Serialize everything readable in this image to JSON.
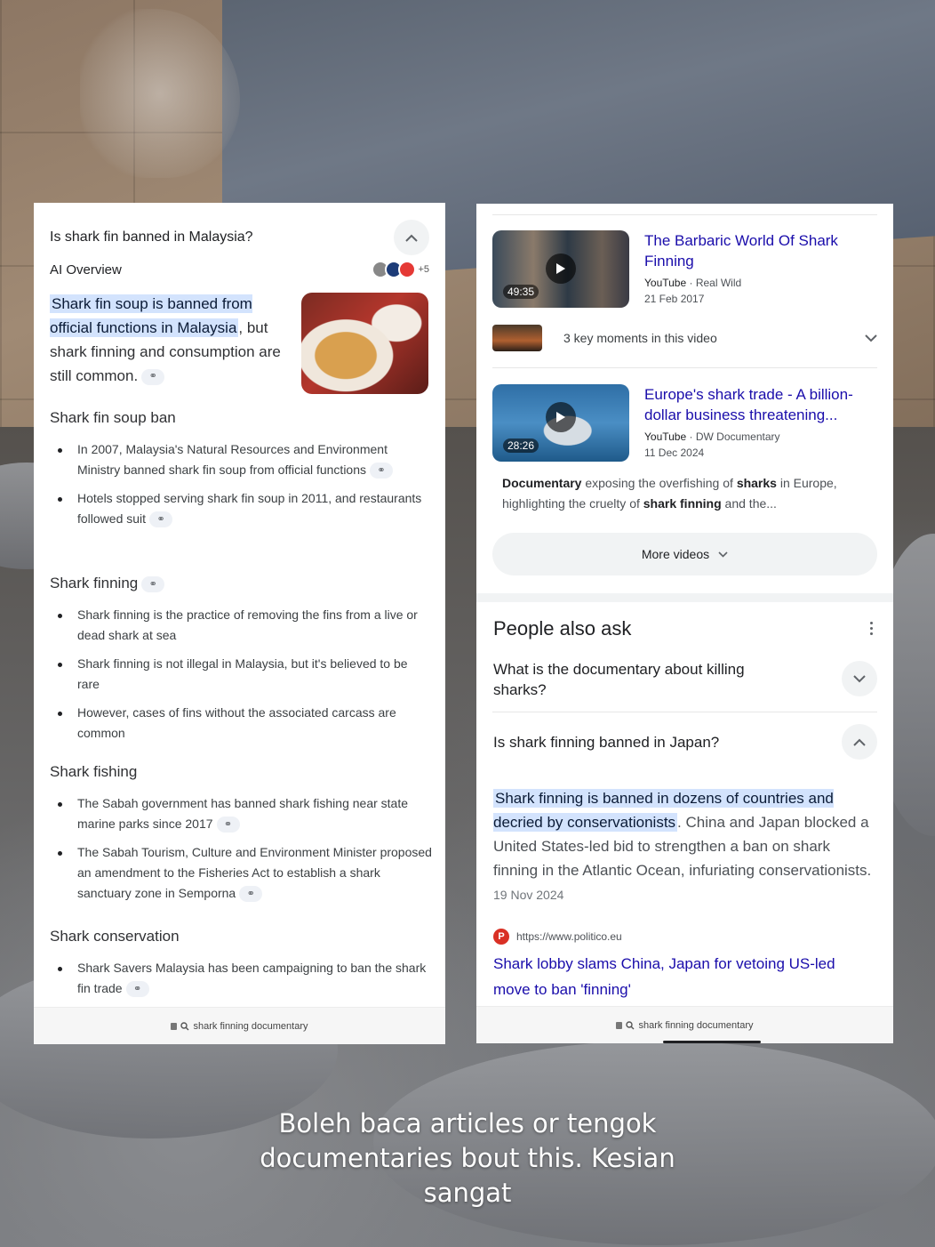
{
  "caption": "Boleh baca articles or tengok documentaries bout this. Kesian sangat",
  "left": {
    "question": "Is shark fin banned in Malaysia?",
    "ai_overview_label": "AI Overview",
    "sources_more": "+5",
    "lead_highlight": "Shark fin soup is banned from official functions in Malaysia",
    "lead_rest": ", but shark finning and consumption are still common.",
    "sections": [
      {
        "heading": "Shark fin soup ban",
        "items": [
          "In 2007, Malaysia's Natural Resources and Environment Ministry banned shark fin soup from official functions",
          "Hotels stopped serving shark fin soup in 2011, and restaurants followed suit"
        ]
      },
      {
        "heading": "Shark finning",
        "items": [
          "Shark finning is the practice of removing the fins from a live or dead shark at sea",
          "Shark finning is not illegal in Malaysia, but it's believed to be rare",
          "However, cases of fins without the associated carcass are common"
        ]
      },
      {
        "heading": "Shark fishing",
        "items": [
          "The Sabah government has banned shark fishing near state marine parks since 2017",
          "The Sabah Tourism, Culture and Environment Minister proposed an amendment to the Fisheries Act to establish a shark sanctuary zone in Semporna"
        ]
      },
      {
        "heading": "Shark conservation",
        "items": [
          "Shark Savers Malaysia has been campaigning to ban the shark fin trade"
        ]
      }
    ],
    "url_bar": "shark finning documentary"
  },
  "right": {
    "videos": [
      {
        "title": "The Barbaric World Of Shark Finning",
        "source": "YouTube",
        "channel": "Real Wild",
        "date": "21 Feb 2017",
        "duration": "49:35"
      },
      {
        "title": "Europe's shark trade - A billion-dollar business threatening...",
        "source": "YouTube",
        "channel": "DW Documentary",
        "date": "11 Dec 2024",
        "duration": "28:26"
      }
    ],
    "key_moments": "3 key moments in this video",
    "description_parts": [
      "Documentary",
      " exposing the overfishing of ",
      "sharks",
      " in Europe, highlighting the cruelty of ",
      "shark finning",
      " and the..."
    ],
    "more_videos": "More videos",
    "paa_title": "People also ask",
    "paa_q1": "What is the documentary about killing sharks?",
    "paa_q2": "Is shark finning banned in Japan?",
    "answer_highlight": "Shark finning is banned in dozens of countries and decried by conservationists",
    "answer_rest": ". China and Japan blocked a United States-led bid to strengthen a ban on shark finning in the Atlantic Ocean, infuriating conservationists.",
    "answer_date": "19 Nov 2024",
    "source_url": "https://www.politico.eu",
    "source_link": "Shark lobby slams China, Japan for vetoing US-led move to ban 'finning'",
    "url_bar": "shark finning documentary"
  },
  "colors": {
    "link": "#1a0dab",
    "highlight": "#d3e3fd"
  }
}
